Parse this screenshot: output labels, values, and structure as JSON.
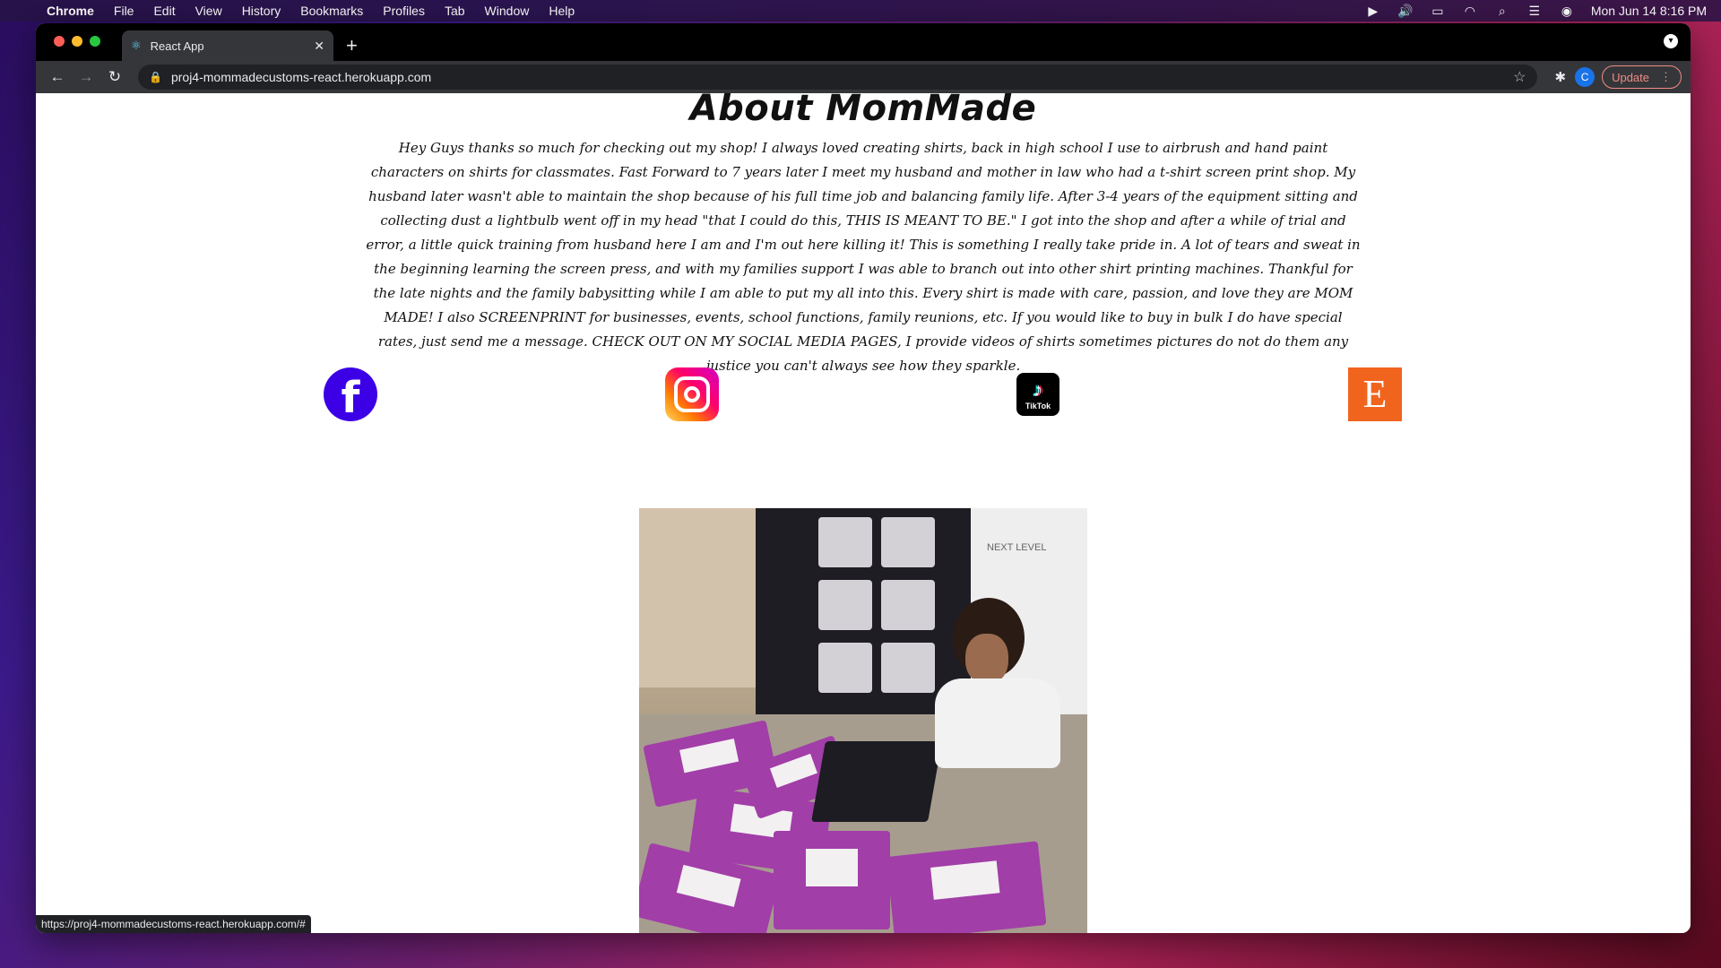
{
  "menubar": {
    "app_name": "Chrome",
    "items": [
      "File",
      "Edit",
      "View",
      "History",
      "Bookmarks",
      "Profiles",
      "Tab",
      "Window",
      "Help"
    ],
    "datetime": "Mon Jun 14  8:16 PM"
  },
  "browser": {
    "tab_title": "React App",
    "url": "proj4-mommadecustoms-react.herokuapp.com",
    "profile_initial": "C",
    "update_label": "Update",
    "status_url": "https://proj4-mommadecustoms-react.herokuapp.com/#"
  },
  "page": {
    "title": "About MomMade",
    "about_text": "Hey Guys thanks so much for checking out my shop! I always loved creating shirts, back in high school I use to airbrush and hand paint characters on shirts for classmates. Fast Forward to 7 years later I meet my husband and mother in law who had a t-shirt screen print shop. My husband later wasn't able to maintain the shop because of his full time job and balancing family life. After 3-4 years of the equipment sitting and collecting dust a lightbulb went off in my head \"that I could do this, THIS IS MEANT TO BE.\" I got into the shop and after a while of trial and error, a little quick training from husband here I am and I'm out here killing it! This is something I really take pride in. A lot of tears and sweat in the beginning learning the screen press, and with my families support I was able to branch out into other shirt printing machines. Thankful for the late nights and the family babysitting while I am able to put my all into this. Every shirt is made with care, passion, and love they are MOM MADE! I also SCREENPRINT for businesses, events, school functions, family reunions, etc. If you would like to buy in bulk I do have special rates, just send me a message. CHECK OUT ON MY SOCIAL MEDIA PAGES, I provide videos of shirts sometimes pictures do not do them any justice you can't always see how they sparkle.",
    "social": {
      "facebook_glyph": "f",
      "tiktok_label": "TikTok",
      "etsy_glyph": "E"
    },
    "photo_box_label": "NEXT LEVEL"
  },
  "colors": {
    "facebook": "#3b00e6",
    "etsy": "#f1641e",
    "mailer": "#a23ea8"
  }
}
